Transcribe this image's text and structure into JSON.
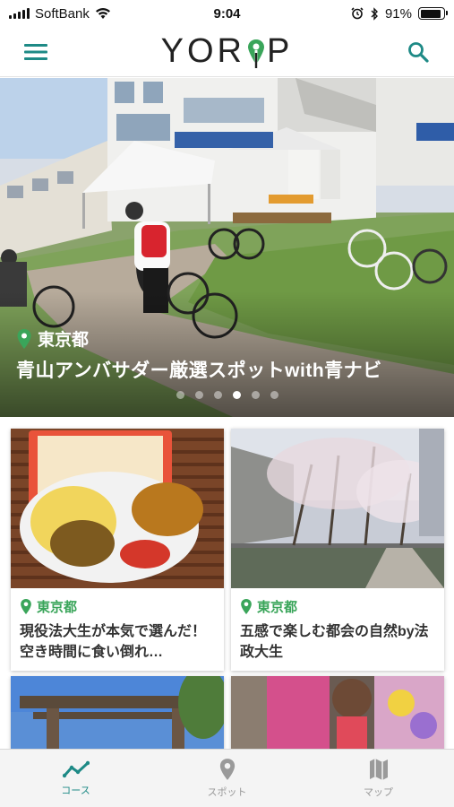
{
  "status_bar": {
    "carrier": "SoftBank",
    "time": "9:04",
    "battery_percent": "91%",
    "battery_level": 0.91
  },
  "header": {
    "logo_text_left": "YOR",
    "logo_text_right": "P",
    "menu_icon": "hamburger-menu-icon",
    "search_icon": "search-icon",
    "accent_color": "#1e8a86",
    "logo_pin_color": "#3aa55a"
  },
  "hero": {
    "location": "東京都",
    "title": "青山アンバサダー厳選スポットwith青ナビ",
    "slide_count": 6,
    "active_slide": 3
  },
  "cards": [
    {
      "location": "東京都",
      "title": "現役法大生が本気で選んだ！空き時間に食い倒れ…"
    },
    {
      "location": "東京都",
      "title": "五感で楽しむ都会の自然by法政大生"
    },
    {
      "location": "",
      "title": ""
    },
    {
      "location": "",
      "title": ""
    }
  ],
  "tab_bar": {
    "items": [
      {
        "label": "コース",
        "icon": "trend-line-icon",
        "active": true
      },
      {
        "label": "スポット",
        "icon": "map-pin-icon",
        "active": false
      },
      {
        "label": "マップ",
        "icon": "folded-map-icon",
        "active": false
      }
    ]
  }
}
